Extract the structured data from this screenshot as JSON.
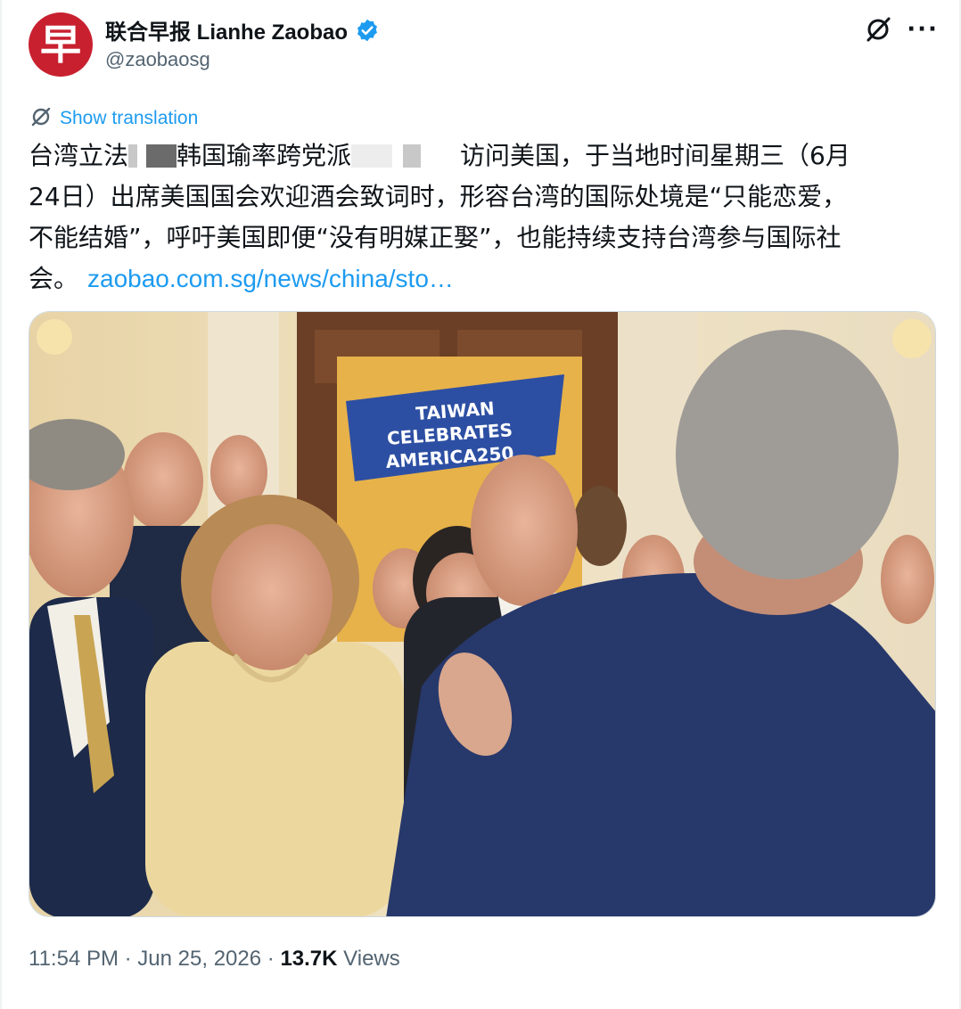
{
  "account": {
    "display_name": "联合早报 Lianhe Zaobao",
    "handle": "@zaobaosg",
    "avatar_glyph": "早",
    "avatar_color": "#c8202f",
    "verified_color": "#1d9bf0"
  },
  "translation": {
    "label": "Show translation"
  },
  "tweet": {
    "line1_a": "台湾立法",
    "line1_b": "韩国瑜率跨党派",
    "line1_c": "访问美国，于当地时间星期三（6月",
    "line2": "24日）出席美国国会欢迎酒会致词时，形容台湾的国际处境是“只能恋爱，",
    "line3": "不能结婚”，呼吁美国即便“没有明媒正娶”，也能持续支持台湾参与国际社",
    "line4": "会。",
    "link": "zaobao.com.sg/news/china/sto…"
  },
  "photo": {
    "banner_lines": [
      "TAIWAN",
      "CELEBRATES",
      "AMERICA250"
    ],
    "banner_color": "#2d4fa3",
    "backdrop_color": "#e7b24a"
  },
  "meta": {
    "time": "11:54 PM",
    "separator": "·",
    "date": "Jun 25, 2026",
    "views_count": "13.7K",
    "views_label": "Views"
  },
  "colors": {
    "link": "#1d9bf0",
    "secondary_text": "#536471",
    "primary_text": "#0f1419"
  }
}
